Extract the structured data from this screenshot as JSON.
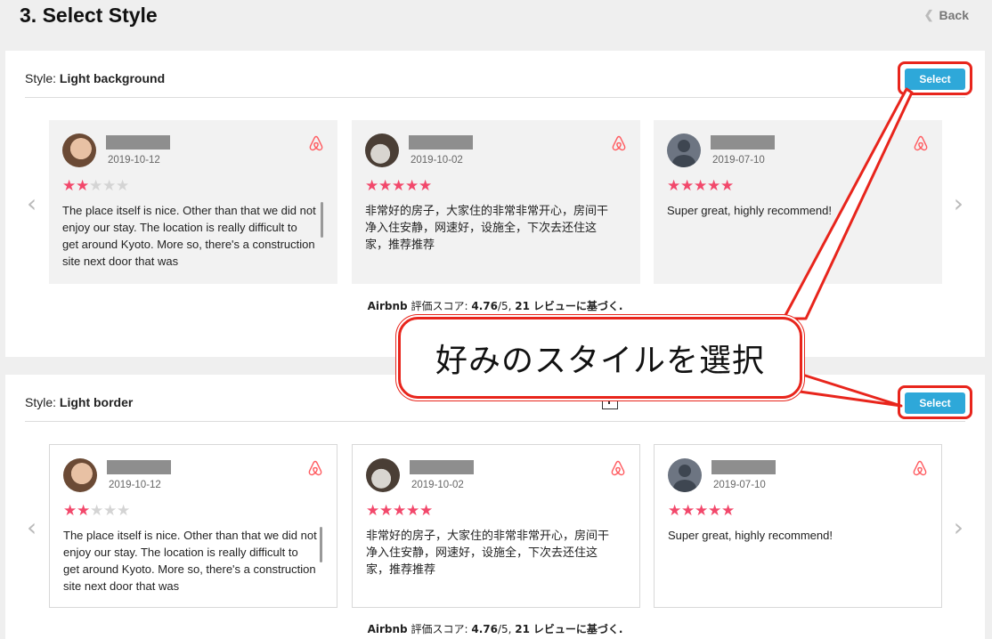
{
  "header": {
    "title": "3. Select Style",
    "back_label": "Back"
  },
  "panels": [
    {
      "style_prefix": "Style:",
      "style_name": "Light background",
      "select_label": "Select",
      "summary": {
        "source": "Airbnb",
        "score_label": "評価スコア:",
        "score": "4.76",
        "score_suffix": "/5,",
        "count": "21",
        "count_suffix": "レビューに基づく."
      }
    },
    {
      "style_prefix": "Style:",
      "style_name": "Light border",
      "select_label": "Select",
      "summary": {
        "source": "Airbnb",
        "score_label": "評価スコア:",
        "score": "4.76",
        "score_suffix": "/5,",
        "count": "21",
        "count_suffix": "レビューに基づく."
      }
    }
  ],
  "reviews": [
    {
      "date": "2019-10-12",
      "rating": 2,
      "text": "The place itself is nice. Other than that we did not enjoy our stay. The location is really difficult to get around Kyoto. More so, there's a construction site next door that was",
      "avatar": "woman-photo"
    },
    {
      "date": "2019-10-02",
      "rating": 5,
      "text": "非常好的房子，大家住的非常非常开心，房间干净入住安静，网速好，设施全，下次去还住这家，推荐推荐",
      "avatar": "dog-photo"
    },
    {
      "date": "2019-07-10",
      "rating": 5,
      "text": "Super great, highly recommend!",
      "avatar": "default-user"
    }
  ],
  "callout": {
    "text": "好みのスタイルを選択"
  },
  "icons": {
    "back": "chevron-left-icon",
    "prev": "chevron-left-icon",
    "next": "chevron-right-icon",
    "source": "airbnb-logo-icon",
    "star": "star-icon"
  },
  "colors": {
    "accent_button": "#2ea8d9",
    "star": "#f2486b",
    "airbnb": "#ff5a5f",
    "annotation": "#e8251c"
  }
}
